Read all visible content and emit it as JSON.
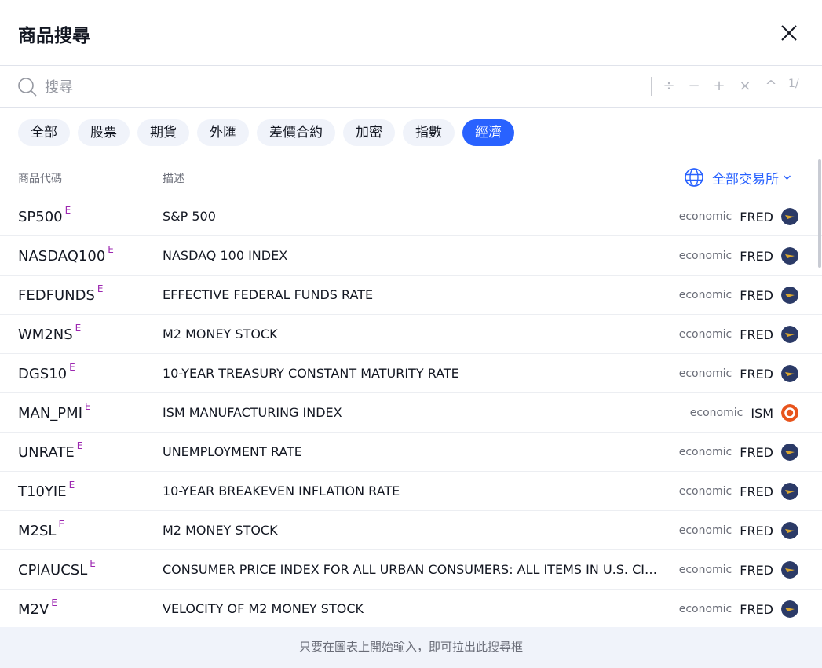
{
  "dialog": {
    "title": "商品搜尋"
  },
  "search": {
    "placeholder": "搜尋"
  },
  "operators": {
    "divide": "÷",
    "minus": "−",
    "plus": "+",
    "multiply": "×",
    "power": "^",
    "reciprocal": "1/"
  },
  "tabs": [
    {
      "label": "全部",
      "active": false
    },
    {
      "label": "股票",
      "active": false
    },
    {
      "label": "期貨",
      "active": false
    },
    {
      "label": "外匯",
      "active": false
    },
    {
      "label": "差價合約",
      "active": false
    },
    {
      "label": "加密",
      "active": false
    },
    {
      "label": "指數",
      "active": false
    },
    {
      "label": "經濟",
      "active": true
    }
  ],
  "columns": {
    "symbol": "商品代碼",
    "description": "描述",
    "exchange_filter": "全部交易所"
  },
  "rows": [
    {
      "symbol": "SP500",
      "badge": "E",
      "description": "S&P 500",
      "type": "economic",
      "exchange": "FRED",
      "logo": "fred-logo"
    },
    {
      "symbol": "NASDAQ100",
      "badge": "E",
      "description": "NASDAQ 100 INDEX",
      "type": "economic",
      "exchange": "FRED",
      "logo": "fred-logo"
    },
    {
      "symbol": "FEDFUNDS",
      "badge": "E",
      "description": "EFFECTIVE FEDERAL FUNDS RATE",
      "type": "economic",
      "exchange": "FRED",
      "logo": "fred-logo"
    },
    {
      "symbol": "WM2NS",
      "badge": "E",
      "description": "M2 MONEY STOCK",
      "type": "economic",
      "exchange": "FRED",
      "logo": "fred-logo"
    },
    {
      "symbol": "DGS10",
      "badge": "E",
      "description": "10-YEAR TREASURY CONSTANT MATURITY RATE",
      "type": "economic",
      "exchange": "FRED",
      "logo": "fred-logo"
    },
    {
      "symbol": "MAN_PMI",
      "badge": "E",
      "description": "ISM MANUFACTURING INDEX",
      "type": "economic",
      "exchange": "ISM",
      "logo": "ism-logo"
    },
    {
      "symbol": "UNRATE",
      "badge": "E",
      "description": "UNEMPLOYMENT RATE",
      "type": "economic",
      "exchange": "FRED",
      "logo": "fred-logo"
    },
    {
      "symbol": "T10YIE",
      "badge": "E",
      "description": "10-YEAR BREAKEVEN INFLATION RATE",
      "type": "economic",
      "exchange": "FRED",
      "logo": "fred-logo"
    },
    {
      "symbol": "M2SL",
      "badge": "E",
      "description": "M2 MONEY STOCK",
      "type": "economic",
      "exchange": "FRED",
      "logo": "fred-logo"
    },
    {
      "symbol": "CPIAUCSL",
      "badge": "E",
      "description": "CONSUMER PRICE INDEX FOR ALL URBAN CONSUMERS: ALL ITEMS IN U.S. CITY A..",
      "type": "economic",
      "exchange": "FRED",
      "logo": "fred-logo"
    },
    {
      "symbol": "M2V",
      "badge": "E",
      "description": "VELOCITY OF M2 MONEY STOCK",
      "type": "economic",
      "exchange": "FRED",
      "logo": "fred-logo"
    }
  ],
  "footer": {
    "hint": "只要在圖表上開始輸入，即可拉出此搜尋框"
  },
  "colors": {
    "accent": "#2962ff",
    "badge": "#9c27b0",
    "fred": "#2b3a67",
    "ism": "#e8541c"
  }
}
